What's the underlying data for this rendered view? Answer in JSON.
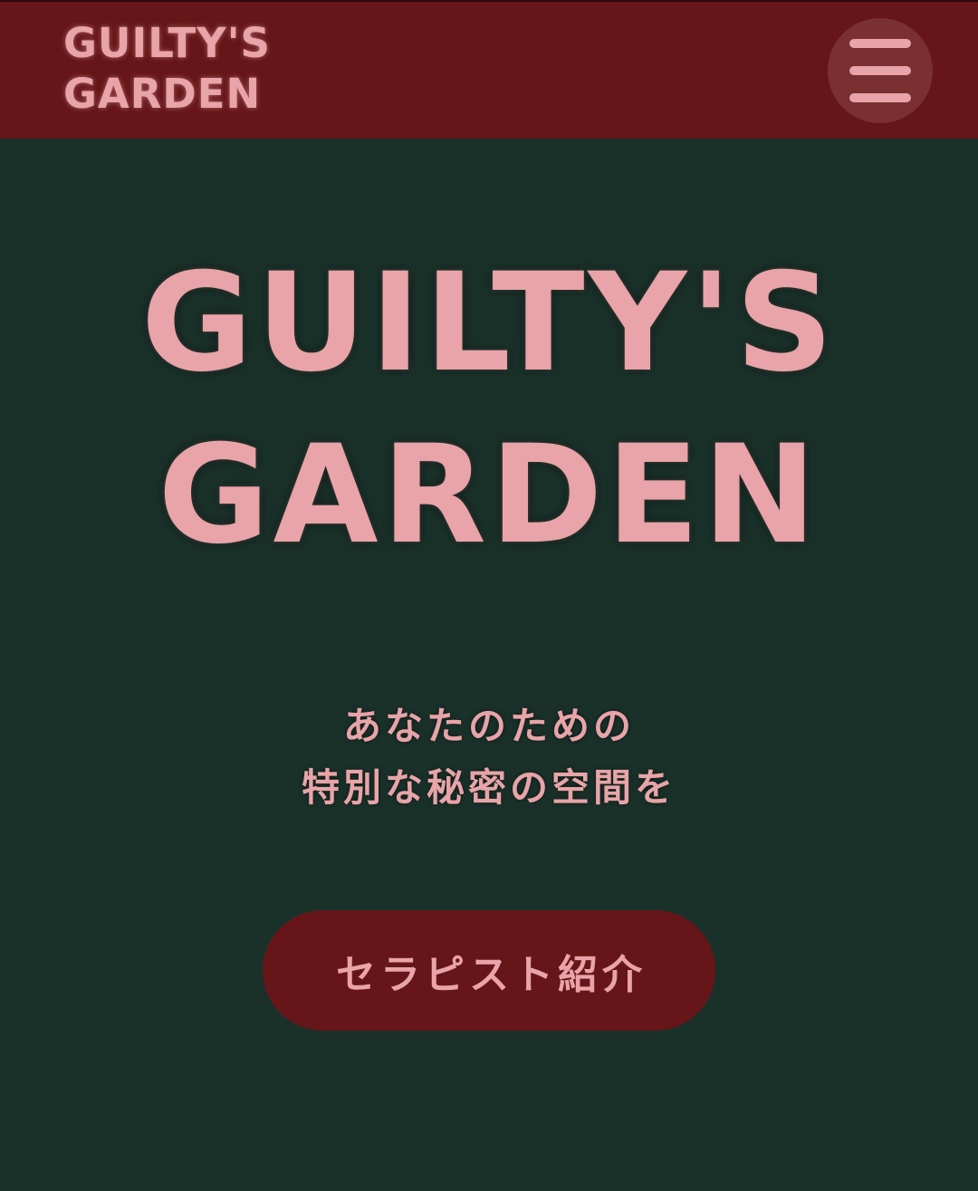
{
  "header": {
    "logo_line1": "GUILTY'S",
    "logo_line2": "GARDEN",
    "menu_icon": "hamburger-menu-icon"
  },
  "hero": {
    "title_line1": "GUILTY'S",
    "title_line2": "GARDEN",
    "tagline_line1": "あなたのための",
    "tagline_line2": "特別な秘密の空間を",
    "cta_label": "セラピスト紹介"
  },
  "colors": {
    "header_bg": "#661618",
    "page_bg": "#1a312a",
    "accent_pink": "#e8a4a8",
    "menu_button_bg": "#7a3030",
    "cta_bg": "#661618"
  }
}
